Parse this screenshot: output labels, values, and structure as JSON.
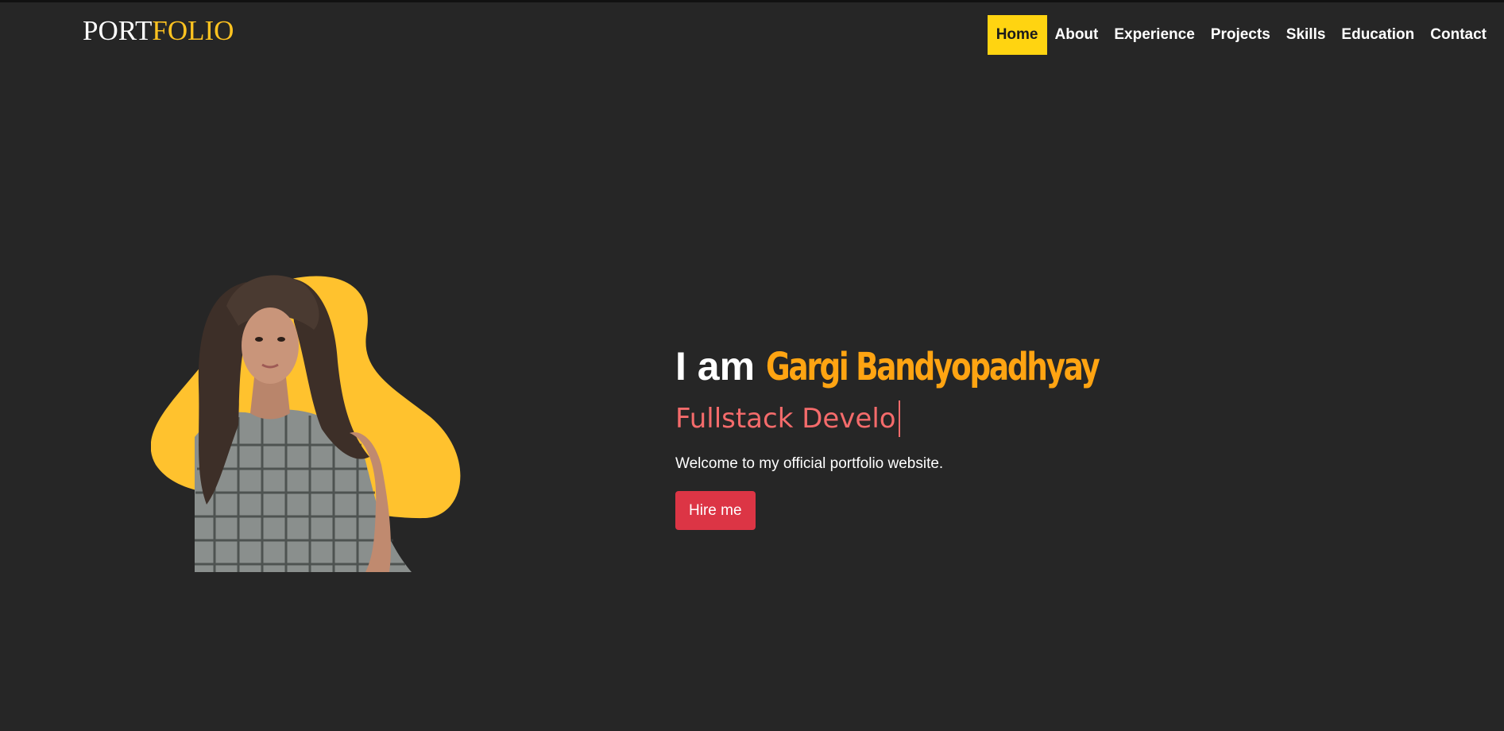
{
  "logo": {
    "part1": "PORT",
    "part2": "FOLIO"
  },
  "nav": {
    "items": [
      {
        "label": "Home",
        "active": true
      },
      {
        "label": "About"
      },
      {
        "label": "Experience"
      },
      {
        "label": "Projects"
      },
      {
        "label": "Skills"
      },
      {
        "label": "Education"
      },
      {
        "label": "Contact"
      }
    ]
  },
  "hero": {
    "intro": "I am ",
    "name": "Gargi Bandyopadhyay",
    "typed_text": "Fullstack Develo",
    "welcome": "Welcome to my official portfolio website.",
    "hire_label": "Hire me"
  },
  "colors": {
    "background": "#262626",
    "accent_yellow": "#ffc320",
    "name_orange": "#ffa412",
    "typed_pink": "#f46b6b",
    "button_red": "#dc3545"
  }
}
